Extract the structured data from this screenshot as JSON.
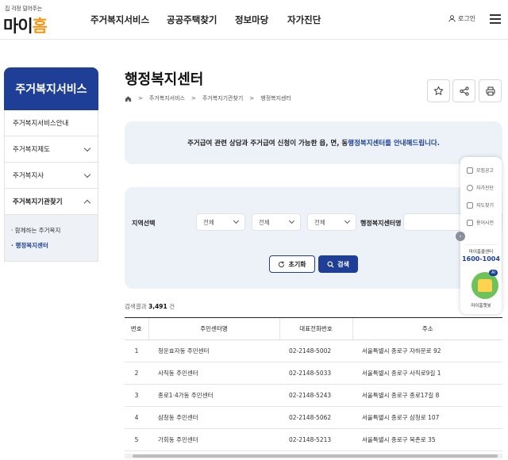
{
  "header": {
    "logo_tagline": "집 걱정 덜어주는",
    "logo_name_a": "마이",
    "logo_name_b": "홈",
    "nav": [
      "주거복지서비스",
      "공공주택찾기",
      "정보마당",
      "자가진단"
    ],
    "login_label": "로그인"
  },
  "sidebar": {
    "title": "주거복지서비스",
    "items": [
      {
        "label": "주거복지서비스안내"
      },
      {
        "label": "주거복지제도"
      },
      {
        "label": "주거복지사"
      },
      {
        "label": "주거복지기관찾기"
      }
    ],
    "subitems": [
      "· 함께하는 주거복지",
      "· 행정복지센터"
    ]
  },
  "page": {
    "title": "행정복지센터",
    "breadcrumb": [
      "주거복지서비스",
      "주거복지기관찾기",
      "행정복지센터"
    ]
  },
  "notice": {
    "text": "주거급여 관련 상담과 주거급여 신청이 가능한 읍, 면, 동 ",
    "highlight": "행정복지센터를 안내해드립니다."
  },
  "search": {
    "region_label": "지역선택",
    "select1": "전체",
    "select2": "전체",
    "select3": "전체",
    "name_label": "행정복지센터명",
    "name_value": "",
    "reset_label": "초기화",
    "search_label": "검색"
  },
  "result": {
    "prefix": "검색결과",
    "count": "3,491",
    "suffix": "건"
  },
  "table": {
    "headers": [
      "번호",
      "주민센터명",
      "대표전화번호",
      "주소"
    ],
    "rows": [
      [
        "1",
        "청운효자동 주민센터",
        "02-2148-5002",
        "서울특별시 종로구 자하문로 92"
      ],
      [
        "2",
        "사직동 주민센터",
        "02-2148-5033",
        "서울특별시 종로구 사직로9길 1"
      ],
      [
        "3",
        "종로1·4가동 주민센터",
        "02-2148-5243",
        "서울특별시 종로구 종로17길 8"
      ],
      [
        "4",
        "삼청동 주민센터",
        "02-2148-5062",
        "서울특별시 종로구 삼청로 107"
      ],
      [
        "5",
        "가회동 주민센터",
        "02-2148-5213",
        "서울특별시 종로구 북촌로 35"
      ]
    ]
  },
  "quick_menu": {
    "items": [
      "모집공고",
      "자가진단",
      "지도찾기",
      "용어사전"
    ],
    "center_label": "마이홈콜센터",
    "phone": "1600-1004",
    "bot_badge": "AI",
    "bot_label": "마이홈챗봇"
  }
}
